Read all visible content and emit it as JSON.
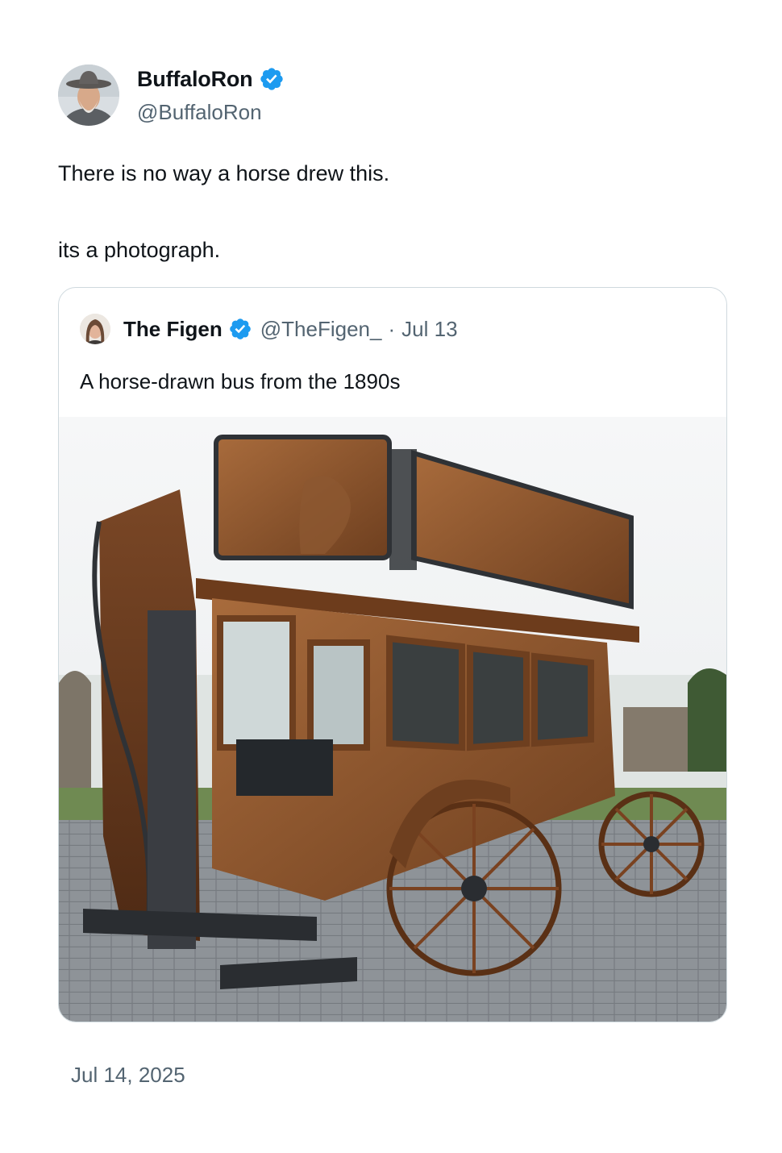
{
  "author": {
    "display_name": "BuffaloRon",
    "handle": "@BuffaloRon",
    "verified_icon": "verified-badge-icon"
  },
  "tweet": {
    "line1": "There is no way a horse drew this.",
    "line2": "its a photograph.",
    "date": "Jul 14, 2025"
  },
  "quoted": {
    "display_name": "The Figen",
    "handle": "@TheFigen_",
    "separator": "·",
    "date": "Jul 13",
    "text": "A horse-drawn bus from the 1890s",
    "media_icon": "horse-drawn-bus-photo"
  },
  "colors": {
    "text": "#0f1419",
    "secondary": "#536471",
    "verified": "#1d9bf0",
    "border": "#cfd9de"
  }
}
